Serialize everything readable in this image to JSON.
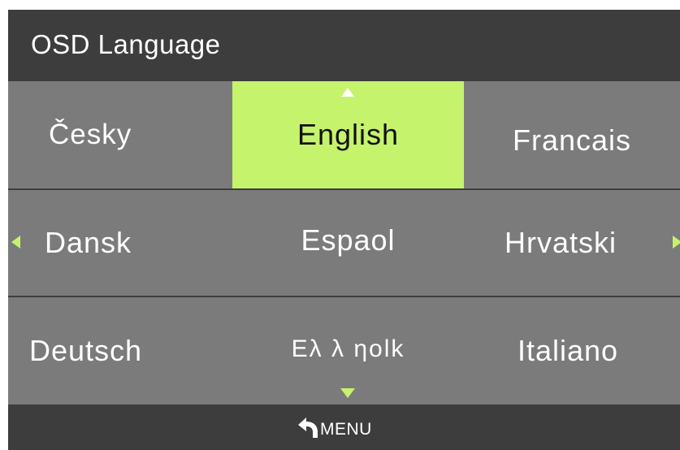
{
  "header": {
    "title": "OSD Language"
  },
  "languages": [
    [
      "Česky",
      "English",
      "Francais"
    ],
    [
      "Dansk",
      "Espaol",
      "Hrvatski"
    ],
    [
      "Deutsch",
      "Ελληνικά",
      "Italiano"
    ]
  ],
  "greek_display": "Eλ λ ηolk",
  "selected": "English",
  "footer": {
    "menu_label": "MENU",
    "menu_icon": "return-arrow-icon"
  },
  "colors": {
    "accent": "#c5f36c",
    "title_bg": "#3d3d3d",
    "panel_bg": "#7b7b7b"
  }
}
